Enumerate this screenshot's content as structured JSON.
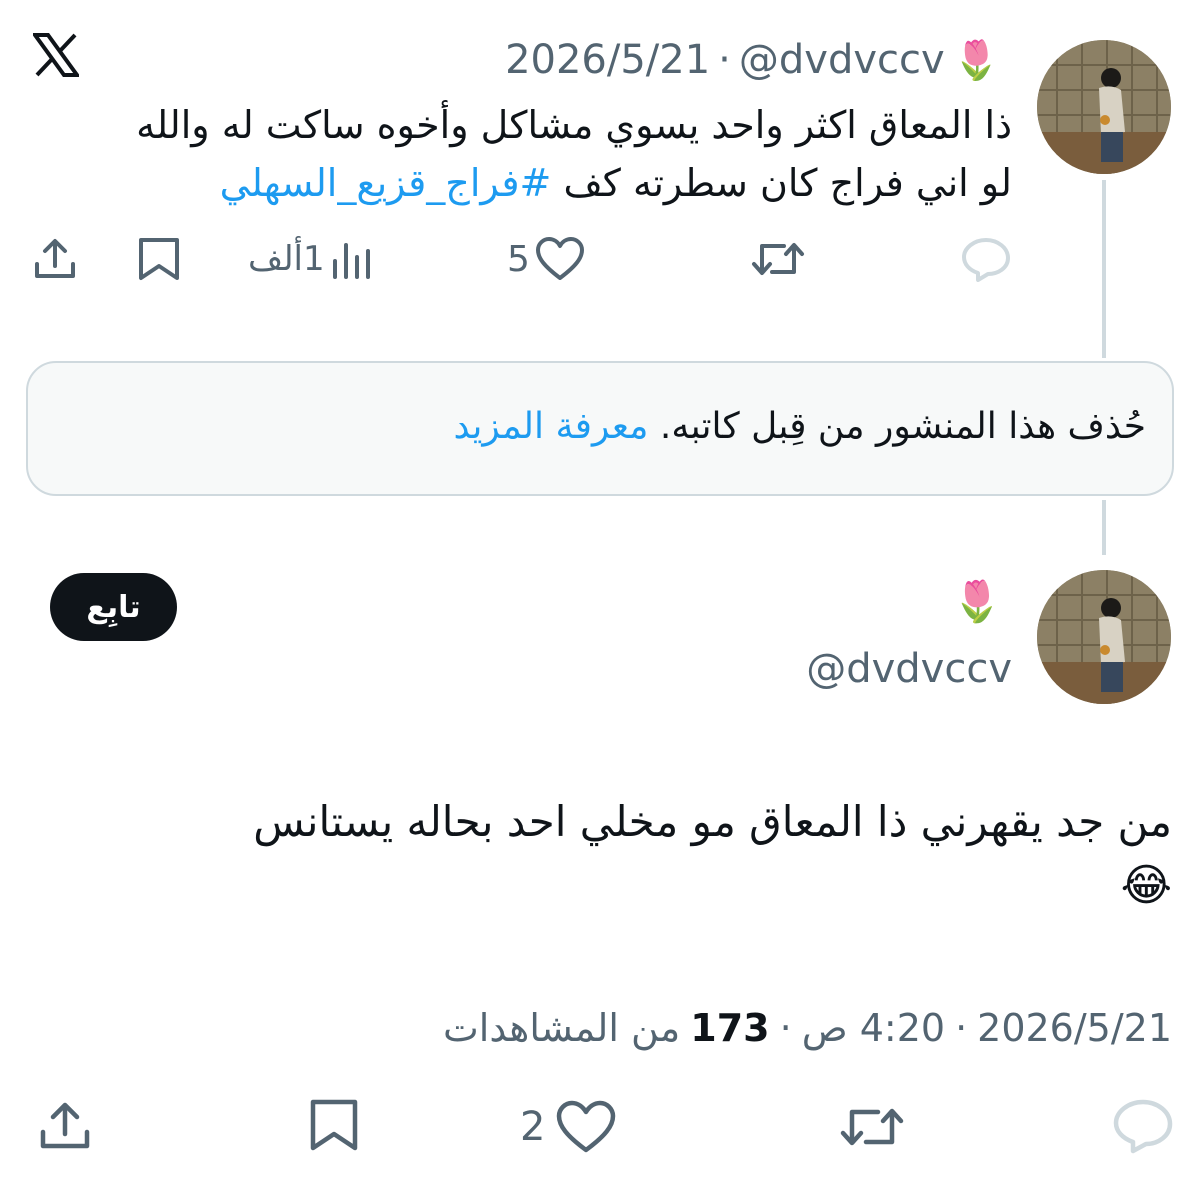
{
  "brand": {
    "logo_icon": "x-logo-icon"
  },
  "quoted_tweet": {
    "author_emoji": "🌷",
    "handle": "@dvdvccv",
    "separator": "·",
    "date": "2026/5/21",
    "text_line1": "ذا المعاق اكثر واحد يسوي مشاكل وأخوه ساكت له والله",
    "text_line2_plain": "لو اني فراج كان سطرته كف ",
    "hashtag": "#فراج_قزيع_السهلي",
    "actions": {
      "reply_icon": "reply-icon",
      "retweet_icon": "retweet-icon",
      "like_icon": "heart-icon",
      "like_count": "5",
      "views_icon": "views-chart-icon",
      "views_count": "1ألف",
      "bookmark_icon": "bookmark-icon",
      "share_icon": "share-icon"
    }
  },
  "deleted_notice": {
    "text": "حُذف هذا المنشور من قِبل كاتبه.",
    "link": "معرفة المزيد"
  },
  "main_tweet": {
    "author_emoji": "🌷",
    "handle": "@dvdvccv",
    "follow_label": "تابِع",
    "text_line1": "من جد يقهرني ذا المعاق مو مخلي احد بحاله يستانس",
    "text_line2": "😂",
    "meta_date": "2026/5/21",
    "meta_sep1": "·",
    "meta_time": "4:20 ص",
    "meta_sep2": "·",
    "views_number": "173",
    "views_label": "من المشاهدات",
    "actions": {
      "reply_icon": "reply-icon",
      "retweet_icon": "retweet-icon",
      "like_icon": "heart-icon",
      "like_count": "2",
      "bookmark_icon": "bookmark-icon",
      "share_icon": "share-icon"
    }
  },
  "colors": {
    "link": "#1d9bf0",
    "muted": "#536471",
    "text": "#0f1419",
    "border": "#cfd9de"
  }
}
